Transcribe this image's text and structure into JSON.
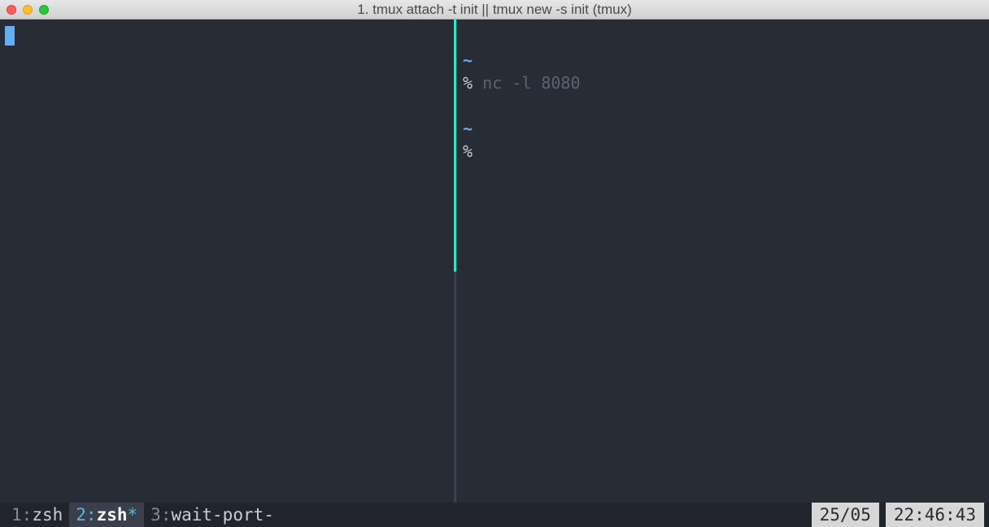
{
  "titlebar": {
    "title": "1. tmux attach -t init || tmux new -s init (tmux)"
  },
  "panes": {
    "right": {
      "line1_tilde": "~",
      "line2_prompt": "%",
      "line2_cmd": " nc -l 8080",
      "line3_tilde": "~",
      "line4_prompt": "%"
    }
  },
  "statusbar": {
    "windows": [
      {
        "index": "1",
        "sep": ":",
        "name": "zsh",
        "flag": ""
      },
      {
        "index": "2",
        "sep": ":",
        "name": "zsh",
        "flag": "*"
      },
      {
        "index": "3",
        "sep": ":",
        "name": "wait-port-",
        "flag": ""
      }
    ],
    "date": "25/05",
    "time": "22:46:43"
  }
}
